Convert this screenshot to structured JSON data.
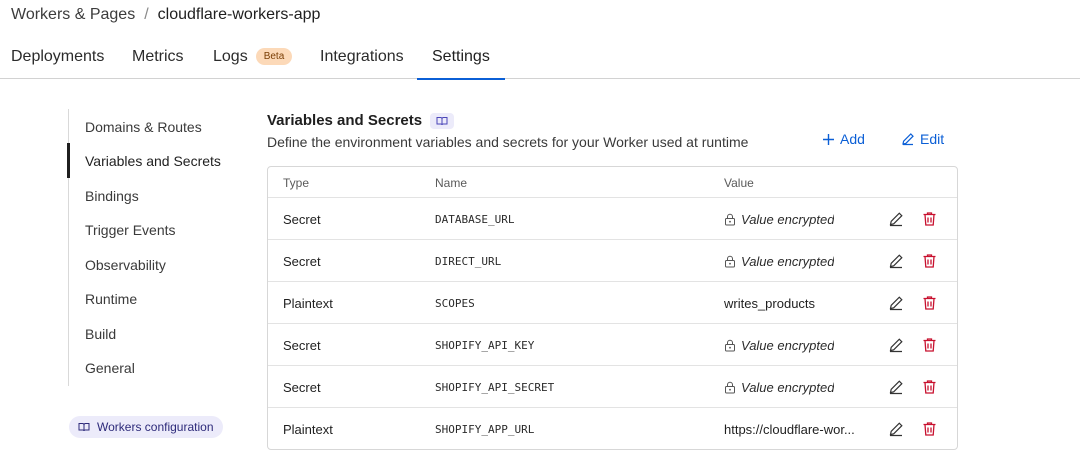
{
  "breadcrumb": {
    "parent": "Workers & Pages",
    "separator": "/",
    "current": "cloudflare-workers-app"
  },
  "tabs": [
    {
      "label": "Deployments"
    },
    {
      "label": "Metrics"
    },
    {
      "label": "Logs",
      "badge": "Beta"
    },
    {
      "label": "Integrations"
    },
    {
      "label": "Settings",
      "active": true
    }
  ],
  "sidebar": {
    "items": [
      {
        "label": "Domains & Routes"
      },
      {
        "label": "Variables and Secrets",
        "active": true
      },
      {
        "label": "Bindings"
      },
      {
        "label": "Trigger Events"
      },
      {
        "label": "Observability"
      },
      {
        "label": "Runtime"
      },
      {
        "label": "Build"
      },
      {
        "label": "General"
      }
    ],
    "config_link": "Workers configuration"
  },
  "section": {
    "title": "Variables and Secrets",
    "description": "Define the environment variables and secrets for your Worker used at runtime",
    "add_label": "Add",
    "edit_label": "Edit"
  },
  "table": {
    "headers": {
      "type": "Type",
      "name": "Name",
      "value": "Value"
    },
    "rows": [
      {
        "type": "Secret",
        "name": "DATABASE_URL",
        "value": "Value encrypted",
        "encrypted": true
      },
      {
        "type": "Secret",
        "name": "DIRECT_URL",
        "value": "Value encrypted",
        "encrypted": true
      },
      {
        "type": "Plaintext",
        "name": "SCOPES",
        "value": "writes_products",
        "encrypted": false
      },
      {
        "type": "Secret",
        "name": "SHOPIFY_API_KEY",
        "value": "Value encrypted",
        "encrypted": true
      },
      {
        "type": "Secret",
        "name": "SHOPIFY_API_SECRET",
        "value": "Value encrypted",
        "encrypted": true
      },
      {
        "type": "Plaintext",
        "name": "SHOPIFY_APP_URL",
        "value": "https://cloudflare-wor...",
        "encrypted": false
      }
    ]
  },
  "colors": {
    "accent": "#0b5fd6",
    "danger": "#c8102e",
    "beta_bg": "#fcd9b8",
    "pill_bg": "#ecebfa"
  },
  "icons": {
    "edit": "pencil-icon",
    "delete": "trash-icon",
    "lock": "lock-icon",
    "add": "plus-icon",
    "docs": "book-icon"
  }
}
